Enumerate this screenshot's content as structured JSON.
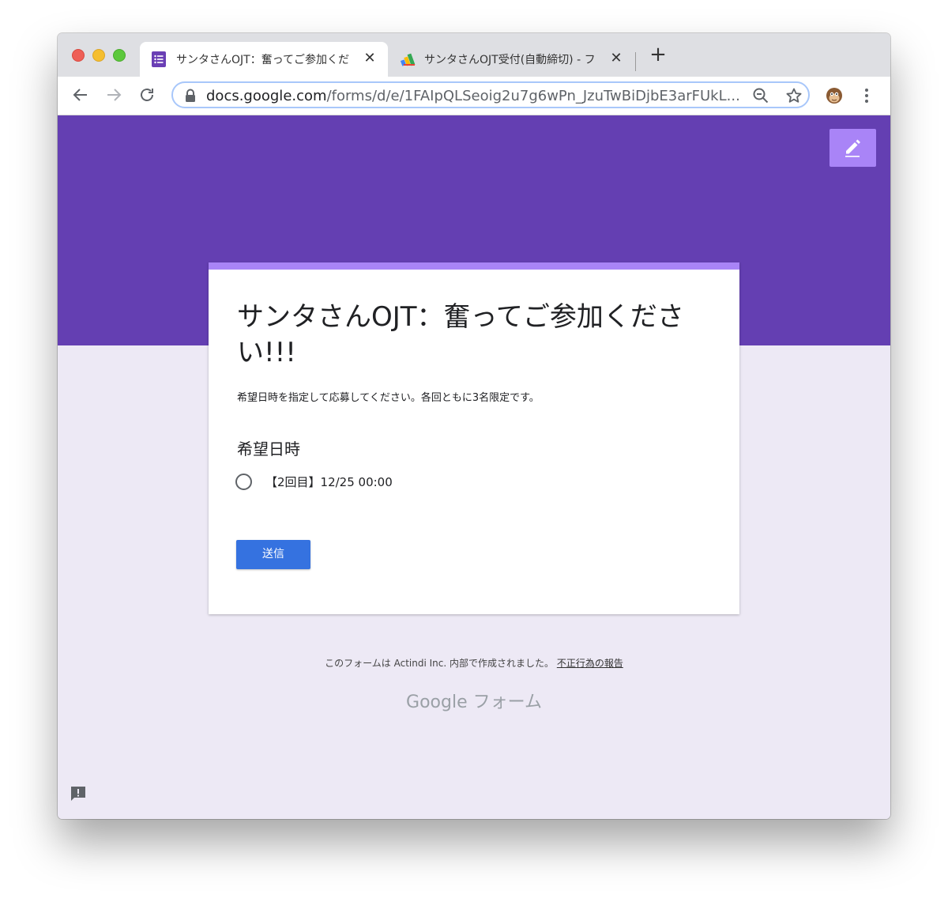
{
  "browser": {
    "tabs": [
      {
        "title": "サンタさんOJT：奮ってご参加くだ",
        "active": true,
        "icon": "google-forms-icon"
      },
      {
        "title": "サンタさんOJT受付(自動締切) - フ",
        "active": false,
        "icon": "apps-script-icon"
      }
    ],
    "url_host": "docs.google.com",
    "url_path": "/forms/d/e/1FAIpQLSeoig2u7g6wPn_JzuTwBiDjbE3arFUkL..."
  },
  "form": {
    "title": "サンタさんOJT：奮ってご参加ください!!!",
    "description": "希望日時を指定して応募してください。各回ともに3名限定です。",
    "question": {
      "title": "希望日時",
      "options": [
        "【2回目】12/25 00:00"
      ]
    },
    "submit_label": "送信"
  },
  "footer": {
    "text": "このフォームは Actindi Inc. 内部で作成されました。",
    "report_link": "不正行為の報告",
    "brand_google": "Google",
    "brand_forms": "フォーム"
  },
  "colors": {
    "banner": "#643fb2",
    "accent": "#a984f7",
    "background": "#ede9f5",
    "submit": "#3572e0"
  }
}
